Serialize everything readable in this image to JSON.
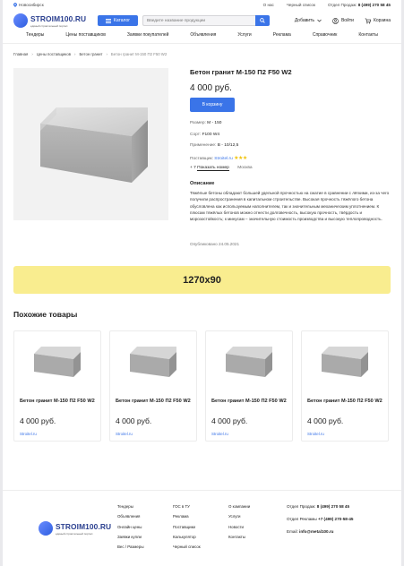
{
  "topbar": {
    "city": "Новосибирск",
    "about": "О нас",
    "blacklist": "Черный список",
    "sales_label": "Отдел Продаж:",
    "sales_phone": "8 (499) 270 58 45"
  },
  "header": {
    "logo_title": "STROIM100.RU",
    "logo_subtitle": "единый строительный портал",
    "catalog_label": "Каталог",
    "search_placeholder": "Введите название продукции",
    "add_label": "Добавить",
    "login_label": "Войти",
    "cart_label": "Корзина"
  },
  "nav": [
    "Тендеры",
    "Цены поставщиков",
    "Заявки покупателей",
    "Объявления",
    "Услуги",
    "Реклама",
    "Справочник",
    "Контакты"
  ],
  "breadcrumbs": [
    "Главная",
    "Цены поставщиков",
    "Бетон гранит",
    "Бетон гранит М-150 П2 F50 W2"
  ],
  "product": {
    "title": "Бетон гранит М-150 П2 F50 W2",
    "price": "4 000 руб.",
    "cart_button": "В корзину",
    "brand_label": "Размер:",
    "brand_value": "М - 150",
    "sort_label": "Сорт:",
    "sort_value": "F100 W4",
    "usage_label": "Применение:",
    "usage_value": "В - 10/12,5",
    "supplier_label": "Поставщик:",
    "supplier_value": "Stroitel.ru",
    "rating": 3,
    "show_phone_prefix": "+ 7",
    "show_phone_label": "Показать номер",
    "city": "Москва",
    "description_heading": "Описание",
    "description": "Тяжёлые бетоны обладают большей удельной прочностью на сжатие в сравнении с лёгкими, из-за чего получили распространения в капитальном строительстве. Высокая прочность тяжёлого бетона обусловлена как используемым наполнителем, так и значительным механическим уплотнением. К плюсам тяжёлых бетонов можно отнести долговечность, высокую прочность, твёрдость и морозостойкость; к минусам – значительную стоимость производства и высокую теплопроводность.",
    "published": "Опубликовано 24.05.2021"
  },
  "banner": {
    "text": "1270x90"
  },
  "similar": {
    "heading": "Похожие товары",
    "items": [
      {
        "title": "Бетон гранит М-150 П2 F50 W2",
        "price": "4 000 руб.",
        "seller": "Stroitel.ru"
      },
      {
        "title": "Бетон гранит М-150 П2 F50 W2",
        "price": "4 000 руб.",
        "seller": "Stroitel.ru"
      },
      {
        "title": "Бетон гранит М-150 П2 F50 W2",
        "price": "4 000 руб.",
        "seller": "Stroitel.ru"
      },
      {
        "title": "Бетон гранит М-150 П2 F50 W2",
        "price": "4 000 руб.",
        "seller": "Stroitel.ru"
      }
    ]
  },
  "footer": {
    "logo_title": "STROIM100.RU",
    "logo_subtitle": "единый строительный портал",
    "col1": [
      "Тендеры",
      "Объявления",
      "Онлайн цены",
      "Заявки купли",
      "Вес / Размеры"
    ],
    "col2": [
      "ГОС в ТУ",
      "Реклама",
      "Поставщики",
      "Калькулятор",
      "Черный список"
    ],
    "col3": [
      "О компании",
      "Услуги",
      "Новости",
      "Контакты"
    ],
    "sales_label": "Отдел Продаж:",
    "sales_phone": "8 (499) 270 58 45",
    "ads_label": "Отдел Рекламы",
    "ads_phone": "+7 (499) 270-58-45",
    "email_label": "Email:",
    "email": "info@metal100.ru"
  }
}
